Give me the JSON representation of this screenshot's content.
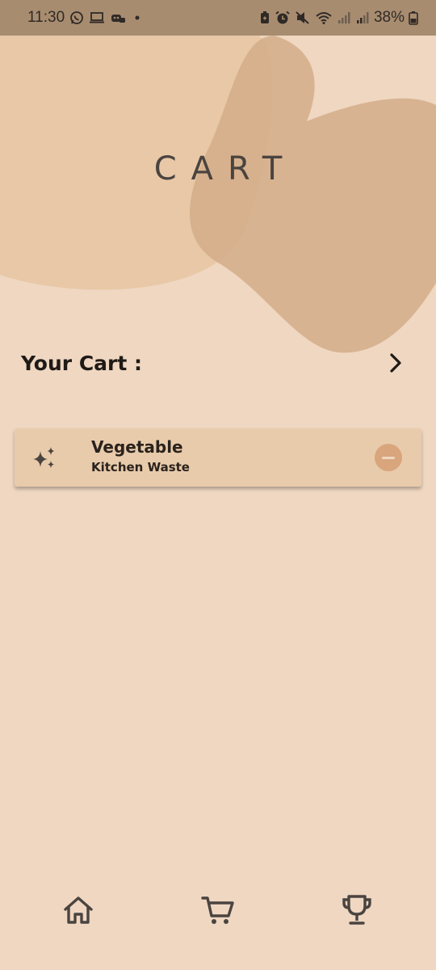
{
  "status_bar": {
    "time": "11:30",
    "battery": "38%",
    "left_icons": [
      "whatsapp-icon",
      "laptop-icon",
      "game-icon",
      "dot-icon"
    ],
    "right_icons": [
      "battery-saver-icon",
      "alarm-icon",
      "mute-icon",
      "wifi-icon",
      "signal-icon",
      "signal-icon"
    ]
  },
  "page": {
    "title": "CART"
  },
  "cart": {
    "label": "Your Cart :",
    "items": [
      {
        "name": "Vegetable",
        "category": "Kitchen Waste",
        "icon": "sparkles-icon"
      }
    ]
  },
  "nav": {
    "items": [
      "home-icon",
      "cart-icon",
      "trophy-icon"
    ]
  },
  "colors": {
    "background": "#efd7c1",
    "status_bar": "#a88c70",
    "blob_light": "#e8c8a6",
    "blob_dark": "#d4ad88",
    "card": "#e8cbab",
    "remove_button": "#d9a57d",
    "text_dark": "#2a221c"
  }
}
